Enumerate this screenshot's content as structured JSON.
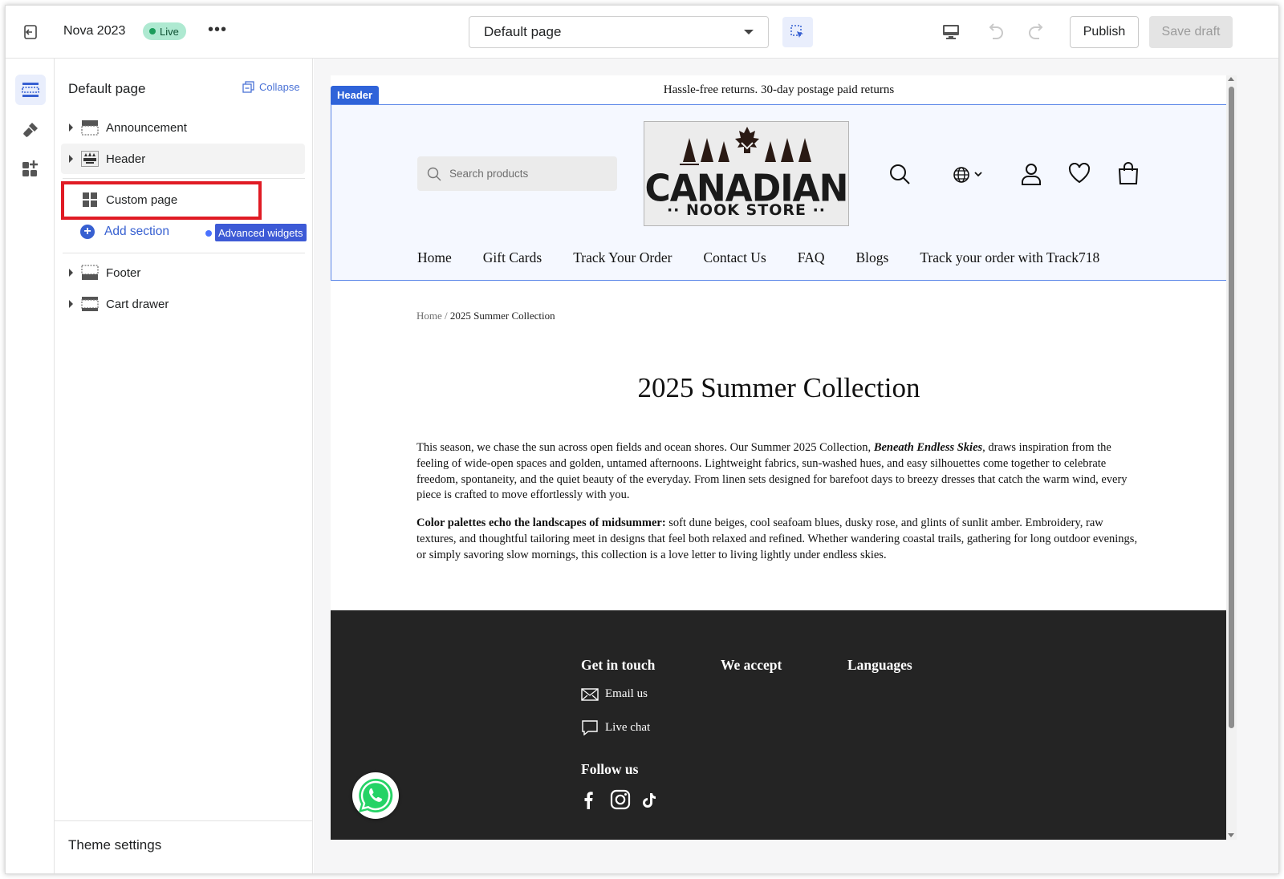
{
  "topbar": {
    "theme_name": "Nova 2023",
    "live_label": "Live",
    "more_label": "•••",
    "page_select": "Default page",
    "publish_label": "Publish",
    "save_draft_label": "Save draft"
  },
  "sidebar": {
    "title": "Default page",
    "collapse_label": "Collapse",
    "sections": {
      "announcement": "Announcement",
      "header": "Header",
      "custom_page": "Custom page",
      "add_section": "Add section",
      "advanced_widgets": "Advanced widgets",
      "footer": "Footer",
      "cart_drawer": "Cart drawer"
    },
    "theme_settings": "Theme settings"
  },
  "preview": {
    "announcement": "Hassle-free returns. 30-day postage paid returns",
    "header_tag": "Header",
    "search_placeholder": "Search products",
    "logo": {
      "word": "CANADIAN",
      "sub": "·· NOOK STORE ··"
    },
    "nav": [
      "Home",
      "Gift Cards",
      "Track Your Order",
      "Contact Us",
      "FAQ",
      "Blogs",
      "Track your order with Track718"
    ],
    "breadcrumb": {
      "home": "Home",
      "sep": " / ",
      "current": "2025 Summer Collection"
    },
    "title": "2025 Summer Collection",
    "para1": {
      "a": "This season, we chase the sun across open fields and ocean shores. Our Summer 2025 Collection, ",
      "em": "Beneath Endless Skies",
      "b": ", draws inspiration from the feeling of wide-open spaces and golden, untamed afternoons. Lightweight fabrics, sun-washed hues, and easy silhouettes come together to celebrate freedom, spontaneity, and the quiet beauty of the everyday. From linen sets designed for barefoot days to breezy dresses that catch the warm wind, every piece is crafted to move effortlessly with you."
    },
    "para2": {
      "strong": "Color palettes echo the landscapes of midsummer:",
      "rest": " soft dune beiges, cool seafoam blues, dusky rose, and glints of sunlit amber. Embroidery, raw textures, and thoughtful tailoring meet in designs that feel both relaxed and refined. Whether wandering coastal trails, gathering for long outdoor evenings, or simply savoring slow mornings, this collection is a love letter to living lightly under endless skies."
    },
    "footer": {
      "get_in_touch": "Get in touch",
      "we_accept": "We accept",
      "languages": "Languages",
      "email_us": "Email us",
      "live_chat": "Live chat",
      "follow_us": "Follow us"
    }
  },
  "colors": {
    "accent": "#3760d1",
    "highlight": "#e01b24",
    "live_bg": "#aee9d1",
    "footer_bg": "#242424",
    "header_outline": "#5a86e8"
  },
  "icons": {
    "exit": "exit-icon",
    "inspect": "inspect-icon",
    "device": "desktop-icon",
    "undo": "undo-icon",
    "redo": "redo-icon",
    "rail": [
      "sections-icon",
      "theme-style-icon",
      "apps-icon"
    ],
    "header_icons": [
      "search-icon",
      "globe-icon",
      "account-icon",
      "wishlist-icon",
      "cart-icon"
    ],
    "social": [
      "facebook-icon",
      "instagram-icon",
      "tiktok-icon"
    ],
    "floating": "whatsapp-icon"
  }
}
